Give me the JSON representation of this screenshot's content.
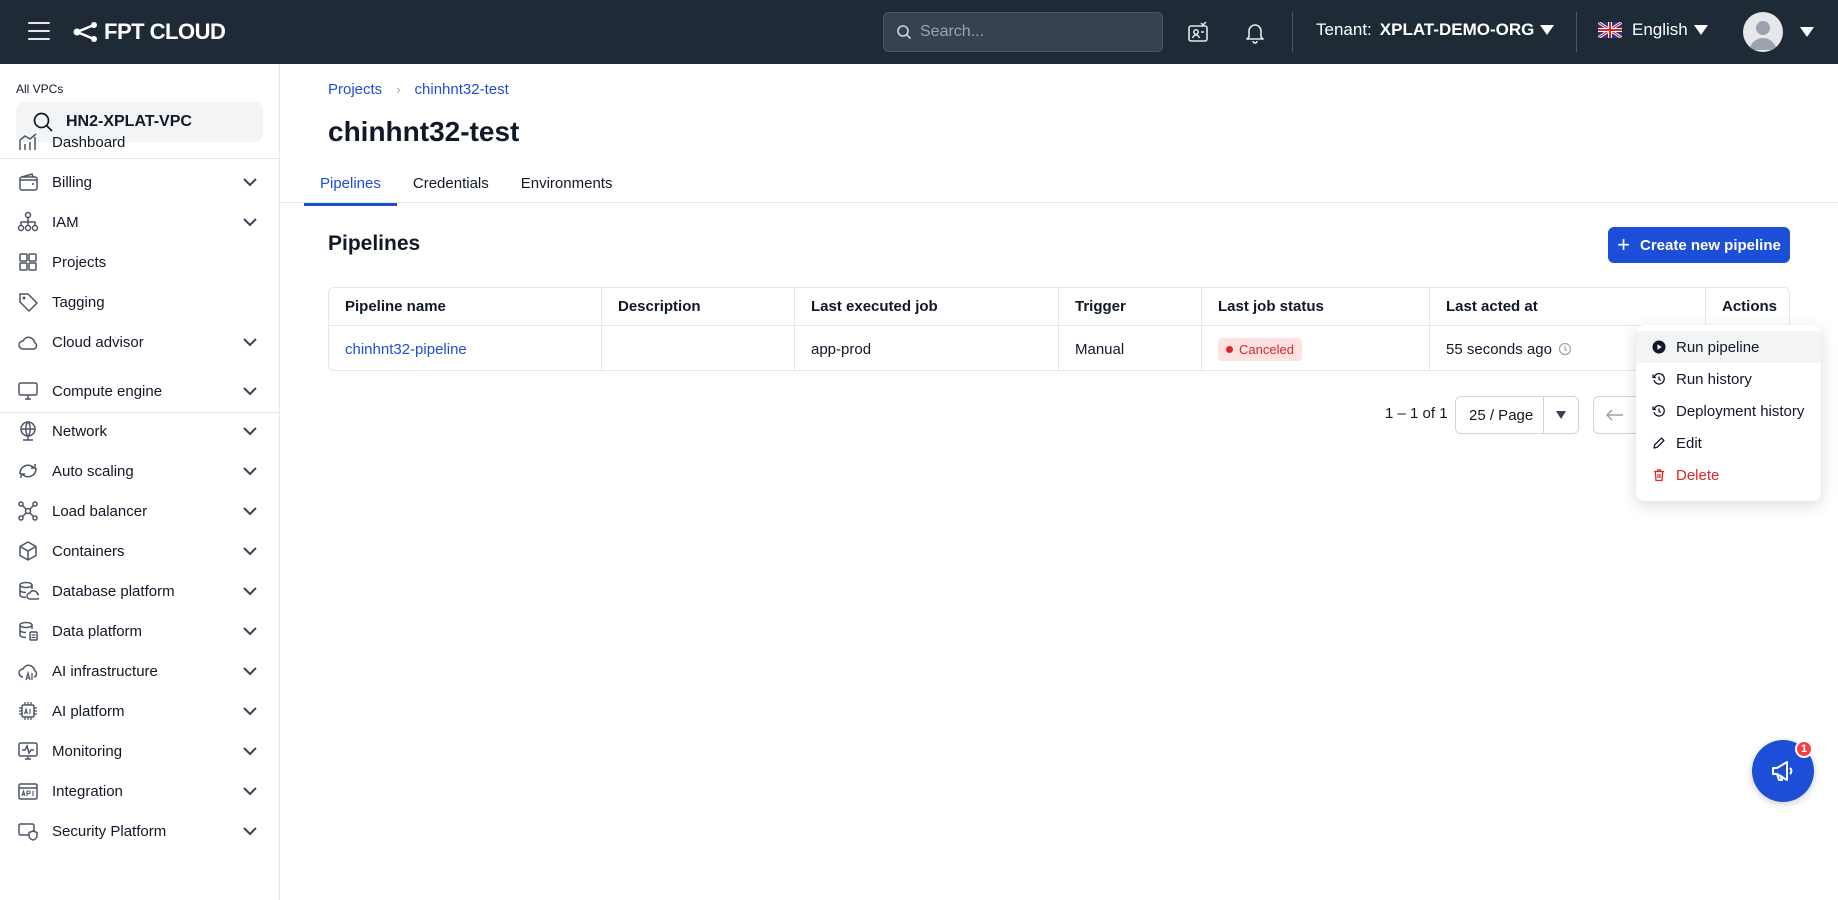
{
  "header": {
    "logo_text": "FPT CLOUD",
    "search_placeholder": "Search...",
    "tenant_label": "Tenant:",
    "tenant_value": "XPLAT-DEMO-ORG",
    "language": "English"
  },
  "sidebar": {
    "vpc_label": "All VPCs",
    "vpc_value": "HN2-XPLAT-VPC",
    "items": [
      {
        "label": "Dashboard",
        "icon": "chart-line-icon",
        "expandable": false
      },
      {
        "label": "Billing",
        "icon": "wallet-icon",
        "expandable": true
      },
      {
        "label": "IAM",
        "icon": "org-tree-icon",
        "expandable": true
      },
      {
        "label": "Projects",
        "icon": "grid-icon",
        "expandable": false
      },
      {
        "label": "Tagging",
        "icon": "tag-icon",
        "expandable": false
      },
      {
        "label": "Cloud advisor",
        "icon": "cloud-icon",
        "expandable": true
      },
      {
        "label": "Compute engine",
        "icon": "monitor-icon",
        "expandable": true
      },
      {
        "label": "Network",
        "icon": "globe-icon",
        "expandable": true
      },
      {
        "label": "Auto scaling",
        "icon": "scaling-icon",
        "expandable": true
      },
      {
        "label": "Load balancer",
        "icon": "hub-icon",
        "expandable": true
      },
      {
        "label": "Containers",
        "icon": "box-icon",
        "expandable": true
      },
      {
        "label": "Database platform",
        "icon": "database-icon",
        "expandable": true
      },
      {
        "label": "Data platform",
        "icon": "data-stack-icon",
        "expandable": true
      },
      {
        "label": "AI infrastructure",
        "icon": "ai-cloud-icon",
        "expandable": true
      },
      {
        "label": "AI platform",
        "icon": "chip-icon",
        "expandable": true
      },
      {
        "label": "Monitoring",
        "icon": "pulse-monitor-icon",
        "expandable": true
      },
      {
        "label": "Integration",
        "icon": "api-icon",
        "expandable": true
      },
      {
        "label": "Security Platform",
        "icon": "shield-icon",
        "expandable": true
      }
    ]
  },
  "breadcrumb": {
    "root": "Projects",
    "current": "chinhnt32-test"
  },
  "page_title": "chinhnt32-test",
  "tabs": [
    "Pipelines",
    "Credentials",
    "Environments"
  ],
  "section_title": "Pipelines",
  "create_button": "Create new pipeline",
  "table": {
    "columns": [
      "Pipeline name",
      "Description",
      "Last executed job",
      "Trigger",
      "Last job status",
      "Last acted at",
      "Actions"
    ],
    "rows": [
      {
        "name": "chinhnt32-pipeline",
        "description": "",
        "last_job": "app-prod",
        "trigger": "Manual",
        "status": "Canceled",
        "last_acted": "55 seconds ago"
      }
    ]
  },
  "pagination": {
    "summary": "1 – 1 of 1",
    "page_size": "25 / Page"
  },
  "action_menu": [
    "Run pipeline",
    "Run history",
    "Deployment history",
    "Edit",
    "Delete"
  ],
  "notification_count": "1",
  "colors": {
    "topbar": "#1f2a37",
    "accent": "#1d4ed8",
    "danger": "#dc2626"
  }
}
